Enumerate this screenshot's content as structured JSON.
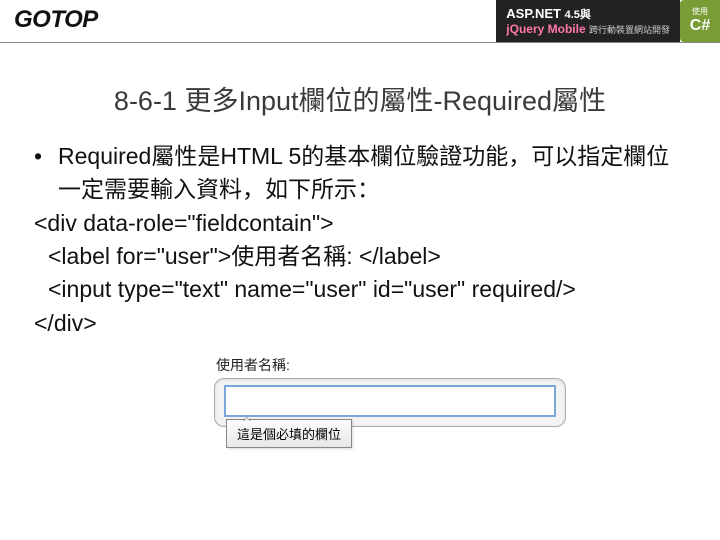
{
  "header": {
    "logo": "GOTOP",
    "badge": {
      "use_label": "使用",
      "csharp": "C#",
      "aspnet": "ASP.NET",
      "version": "4.5與",
      "jqm": "jQuery Mobile",
      "tagline": "跨行動裝置網站開發"
    }
  },
  "slide": {
    "title": "8-6-1 更多Input欄位的屬性-Required屬性",
    "bullet": "Required屬性是HTML 5的基本欄位驗證功能，可以指定欄位一定需要輸入資料，如下所示：",
    "code": {
      "line1": "<div data-role=\"fieldcontain\">",
      "line2": "<label for=\"user\">使用者名稱: </label>",
      "line3": "<input type=\"text\" name=\"user\" id=\"user\" required/>",
      "line4": "</div>"
    }
  },
  "demo": {
    "label": "使用者名稱:",
    "input_value": "",
    "tooltip": "這是個必填的欄位"
  }
}
